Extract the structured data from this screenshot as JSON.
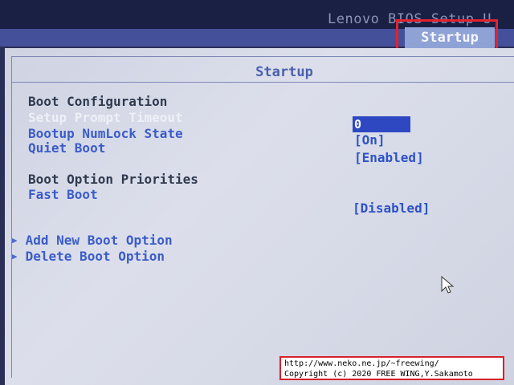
{
  "header": {
    "title": "Lenovo BIOS Setup U",
    "active_tab": "Startup"
  },
  "panel": {
    "title": "Startup",
    "boot_configuration": "Boot Configuration",
    "setup_prompt_timeout": "Setup Prompt Timeout",
    "setup_prompt_timeout_value": "0",
    "bootup_numlock_state": "Bootup NumLock State",
    "bootup_numlock_state_value": "[On]",
    "quiet_boot": "Quiet Boot",
    "quiet_boot_value": "[Enabled]",
    "boot_option_priorities": "Boot Option Priorities",
    "fast_boot": "Fast Boot",
    "fast_boot_value": "[Disabled]",
    "add_new_boot_option": "Add New Boot Option",
    "delete_boot_option": "Delete Boot Option"
  },
  "credit": {
    "line1": "http://www.neko.ne.jp/~freewing/",
    "line2": "Copyright (c) 2020 FREE WING,Y.Sakamoto"
  },
  "colors": {
    "highlight_border": "#e3222e",
    "item_text": "#3b5cc9",
    "selected_value_bg": "#2e48c2"
  },
  "icons": {
    "submenu": "triangle-right",
    "pointer": "mouse-cursor"
  }
}
